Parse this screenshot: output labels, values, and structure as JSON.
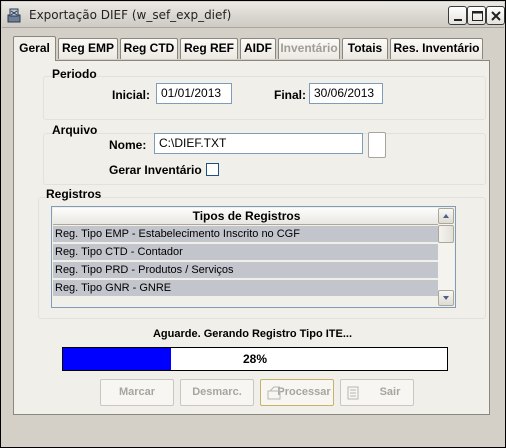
{
  "window": {
    "title": "Exportação DIEF (w_sef_exp_dief)",
    "controls": [
      "minimize-icon",
      "maximize-icon",
      "close-icon"
    ]
  },
  "tabs": [
    {
      "label": "Geral",
      "active": true,
      "enabled": true
    },
    {
      "label": "Reg EMP",
      "active": false,
      "enabled": true
    },
    {
      "label": "Reg CTD",
      "active": false,
      "enabled": true
    },
    {
      "label": "Reg REF",
      "active": false,
      "enabled": true
    },
    {
      "label": "AIDF",
      "active": false,
      "enabled": true
    },
    {
      "label": "Inventário",
      "active": false,
      "enabled": false
    },
    {
      "label": "Totais",
      "active": false,
      "enabled": true
    },
    {
      "label": "Res. Inventário",
      "active": false,
      "enabled": true
    }
  ],
  "periodo": {
    "heading": "Periodo",
    "inicial_label": "Inicial:",
    "inicial_value": "01/01/2013",
    "final_label": "Final:",
    "final_value": "30/06/2013"
  },
  "arquivo": {
    "heading": "Arquivo",
    "nome_label": "Nome:",
    "nome_value": "C:\\DIEF.TXT",
    "gerar_inventario_label": "Gerar Inventário",
    "gerar_inventario_checked": false
  },
  "registros": {
    "heading": "Registros",
    "column_header": "Tipos de Registros",
    "rows": [
      "Reg. Tipo EMP - Estabelecimento Inscrito no CGF",
      "Reg. Tipo CTD - Contador",
      "Reg. Tipo PRD - Produtos / Serviços",
      "Reg. Tipo GNR - GNRE"
    ]
  },
  "status": {
    "message": "Aguarde. Gerando Registro Tipo ITE...",
    "progress_label": "28%",
    "progress_fraction": 0.28,
    "progress_color": "#0000ff"
  },
  "buttons": {
    "marcar": "Marcar",
    "desmarcar": "Desmarc.",
    "processar": "Processar",
    "sair": "Sair"
  }
}
